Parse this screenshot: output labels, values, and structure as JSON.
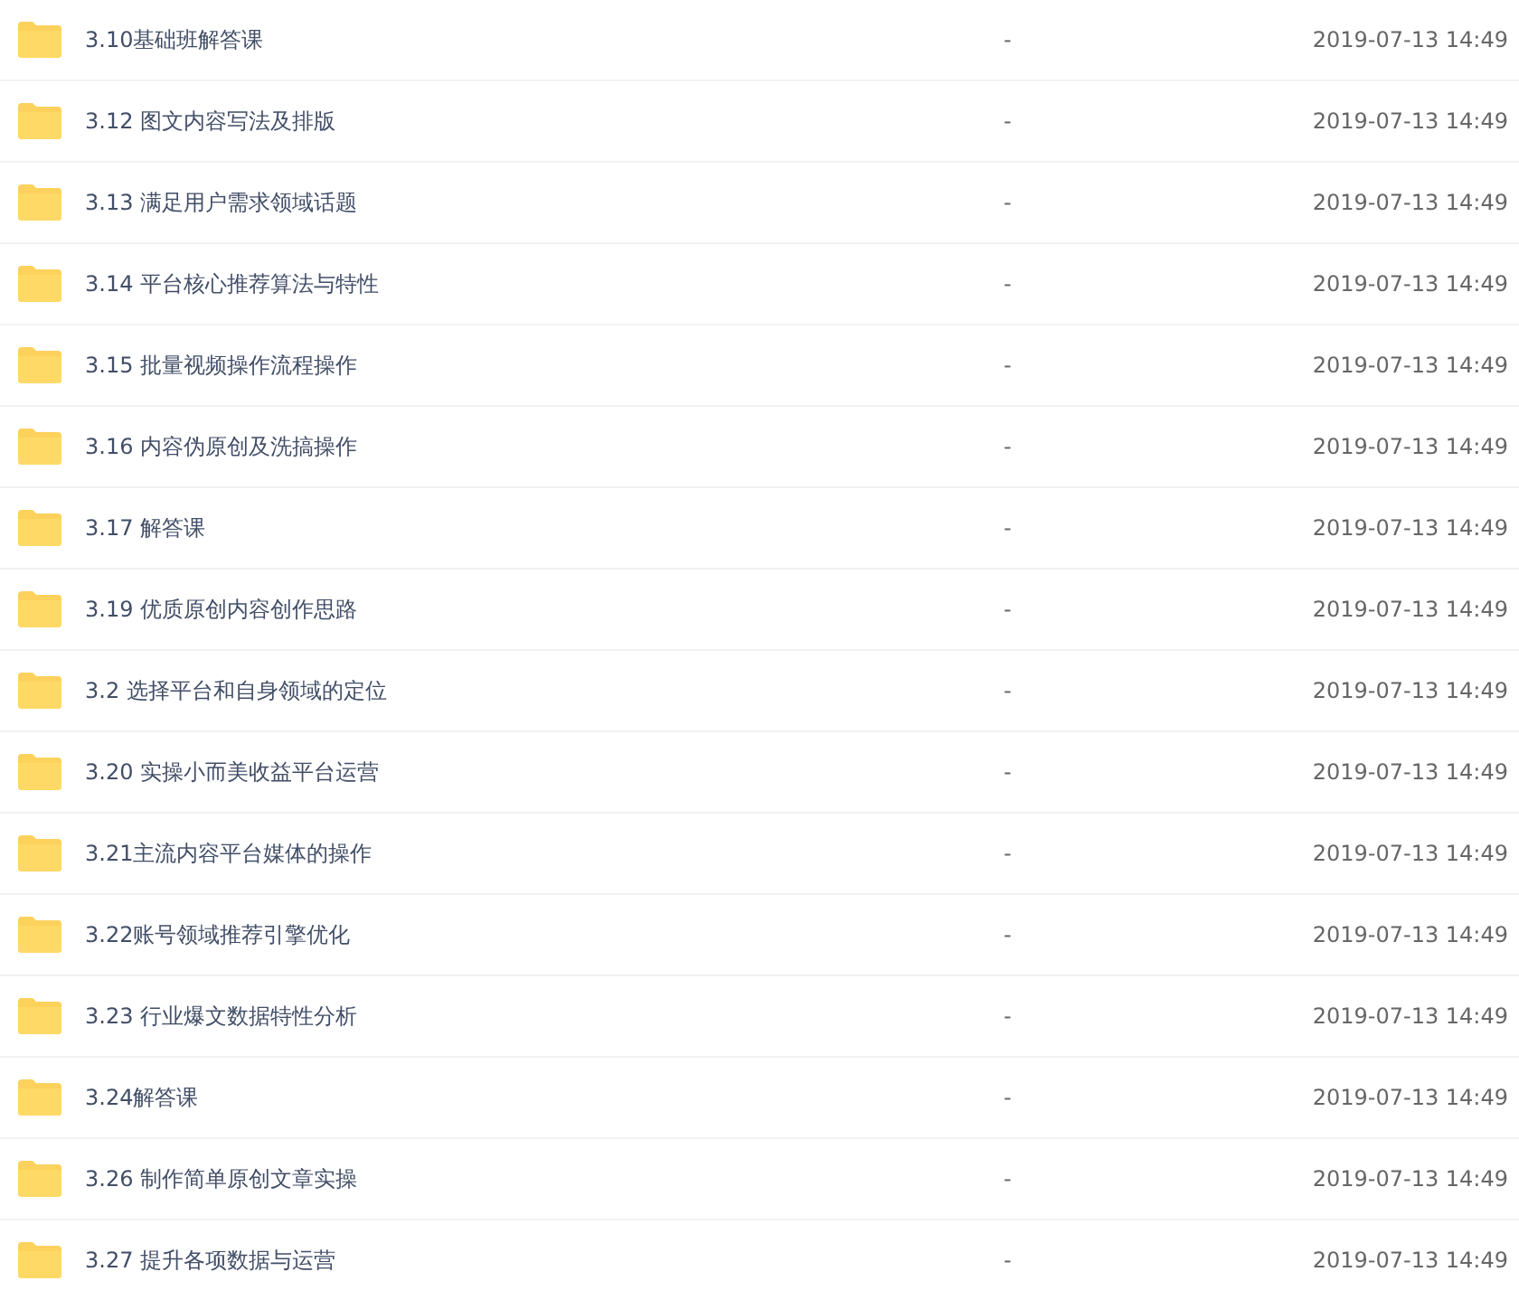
{
  "files": [
    {
      "name": "3.10基础班解答课",
      "size": "-",
      "modified": "2019-07-13 14:49"
    },
    {
      "name": "3.12 图文内容写法及排版",
      "size": "-",
      "modified": "2019-07-13 14:49"
    },
    {
      "name": "3.13 满足用户需求领域话题",
      "size": "-",
      "modified": "2019-07-13 14:49"
    },
    {
      "name": "3.14 平台核心推荐算法与特性",
      "size": "-",
      "modified": "2019-07-13 14:49"
    },
    {
      "name": "3.15 批量视频操作流程操作",
      "size": "-",
      "modified": "2019-07-13 14:49"
    },
    {
      "name": "3.16 内容伪原创及洗搞操作",
      "size": "-",
      "modified": "2019-07-13 14:49"
    },
    {
      "name": "3.17 解答课",
      "size": "-",
      "modified": "2019-07-13 14:49"
    },
    {
      "name": "3.19 优质原创内容创作思路",
      "size": "-",
      "modified": "2019-07-13 14:49"
    },
    {
      "name": "3.2 选择平台和自身领域的定位",
      "size": "-",
      "modified": "2019-07-13 14:49"
    },
    {
      "name": "3.20 实操小而美收益平台运营",
      "size": "-",
      "modified": "2019-07-13 14:49"
    },
    {
      "name": "3.21主流内容平台媒体的操作",
      "size": "-",
      "modified": "2019-07-13 14:49"
    },
    {
      "name": "3.22账号领域推荐引擎优化",
      "size": "-",
      "modified": "2019-07-13 14:49"
    },
    {
      "name": "3.23 行业爆文数据特性分析",
      "size": "-",
      "modified": "2019-07-13 14:49"
    },
    {
      "name": "3.24解答课",
      "size": "-",
      "modified": "2019-07-13 14:49"
    },
    {
      "name": "3.26 制作简单原创文章实操",
      "size": "-",
      "modified": "2019-07-13 14:49"
    },
    {
      "name": "3.27 提升各项数据与运营",
      "size": "-",
      "modified": "2019-07-13 14:49"
    }
  ]
}
